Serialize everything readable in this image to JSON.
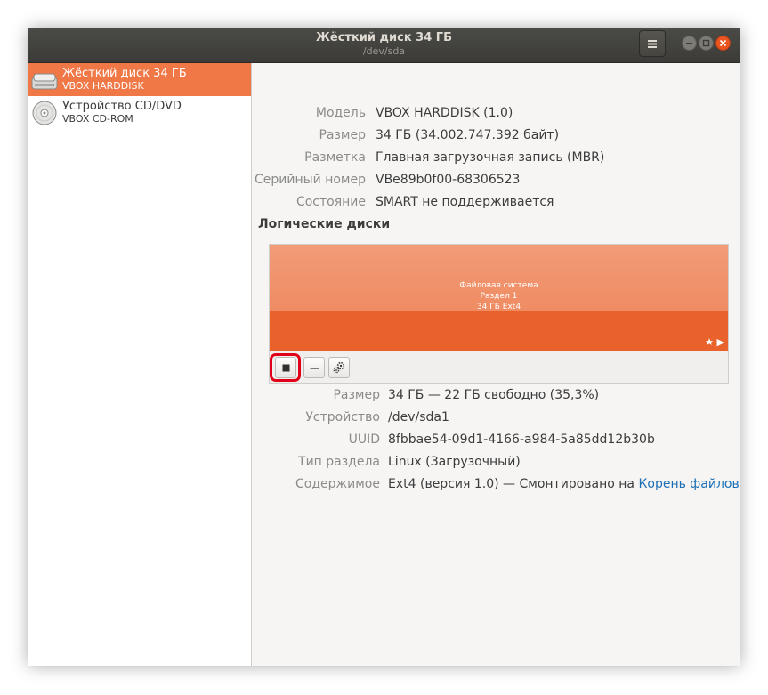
{
  "window": {
    "title": "Жёсткий диск 34 ГБ",
    "subtitle": "/dev/sda"
  },
  "sidebar": {
    "items": [
      {
        "name": "Жёсткий диск 34 ГБ",
        "model": "VBOX HARDDISK",
        "selected": true,
        "icon": "hard-disk-icon"
      },
      {
        "name": "Устройство CD/DVD",
        "model": "VBOX CD-ROM",
        "selected": false,
        "icon": "optical-disc-icon"
      }
    ]
  },
  "drive_info": {
    "model_label": "Модель",
    "model_value": "VBOX HARDDISK (1.0)",
    "size_label": "Размер",
    "size_value": "34 ГБ (34.002.747.392 байт)",
    "partitioning_label": "Разметка",
    "partitioning_value": "Главная загрузочная запись (MBR)",
    "serial_label": "Серийный номер",
    "serial_value": "VBe89b0f00-68306523",
    "state_label": "Состояние",
    "state_value": "SMART не поддерживается"
  },
  "volumes": {
    "title": "Логические диски",
    "partition": {
      "line1": "Файловая система",
      "line2": "Раздел 1",
      "line3": "34 ГБ Ext4"
    },
    "toolbar": {
      "stop_label": "■",
      "delete_label": "–",
      "settings_icon": "gears-icon"
    }
  },
  "partition_info": {
    "size_label": "Размер",
    "size_value": "34 ГБ — 22 ГБ свободно (35,3%)",
    "device_label": "Устройство",
    "device_value": "/dev/sda1",
    "uuid_label": "UUID",
    "uuid_value": "8fbbae54-09d1-4166-a984-5a85dd12b30b",
    "type_label": "Тип раздела",
    "type_value": "Linux (Загрузочный)",
    "contents_label": "Содержимое",
    "contents_value": "Ext4 (версия 1.0) — Смонтировано на ",
    "contents_link": "Корень файловой …"
  },
  "colors": {
    "accent": "#f07746",
    "partition": "#e9612b",
    "highlight": "#e0001a",
    "titlebar": "#3c3b37"
  }
}
